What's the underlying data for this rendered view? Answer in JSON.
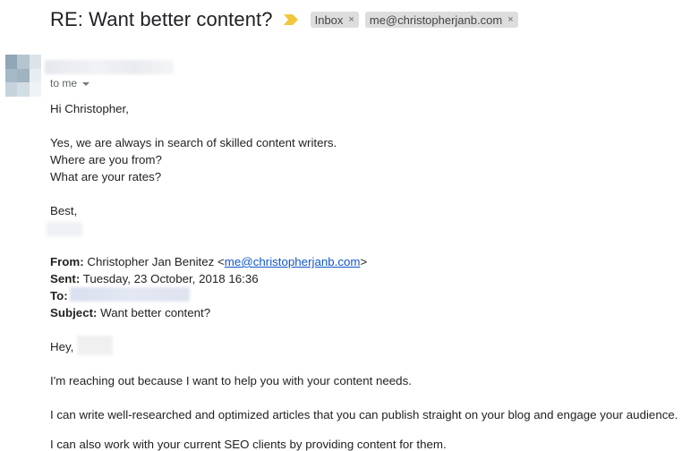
{
  "header": {
    "subject": "RE: Want better content?",
    "labels": [
      {
        "text": "Inbox",
        "close": "×"
      },
      {
        "text": "me@christopherjanb.com",
        "close": "×"
      }
    ]
  },
  "sender": {
    "recipient_toggle": "to me"
  },
  "reply": {
    "greeting": "Hi Christopher,",
    "line1": "Yes, we are always in search of skilled content writers.",
    "line2": "Where are you from?",
    "line3": "What are your rates?",
    "signoff": "Best,"
  },
  "quoted": {
    "from_label": "From:",
    "from_name": "Christopher Jan Benitez <",
    "from_email": "me@christopherjanb.com",
    "from_close": ">",
    "sent_label": "Sent:",
    "sent_value": "Tuesday, 23 October, 2018 16:36",
    "to_label": "To:",
    "subject_label": "Subject:",
    "subject_value": "Want better content?",
    "hey": "Hey,",
    "para1": "I'm reaching out because I want to help you with your content needs.",
    "para2": "I can write well-researched and optimized articles that you can publish straight on your blog and engage your audience.",
    "para3": "I can also work with your current SEO clients by providing content for them."
  },
  "colors": {
    "important_marker": "#f2c73d",
    "chip_bg": "#dddddd",
    "link": "#1155cc"
  },
  "icons": {
    "important": "important-marker-icon",
    "caret": "chevron-down-icon",
    "remove": "close-icon"
  }
}
